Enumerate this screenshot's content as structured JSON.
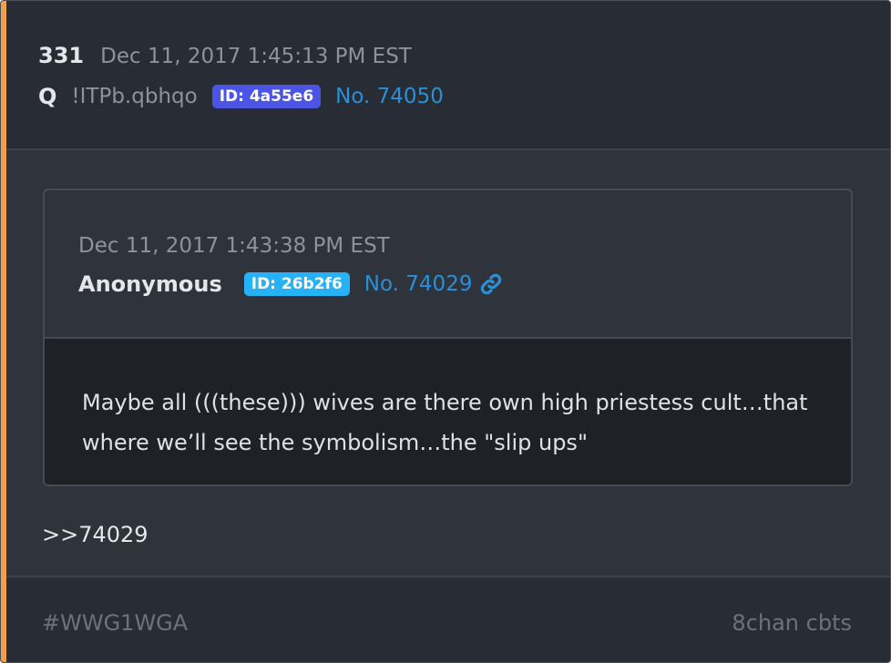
{
  "post": {
    "number": "331",
    "date": "Dec 11, 2017 1:45:13 PM EST",
    "author": "Q",
    "tripcode": "!ITPb.qbhqo",
    "id_label": "ID: 4a55e6",
    "id_color": "#4a55e6",
    "post_no": "No. 74050",
    "accent_color": "#f0a04b"
  },
  "quoted": {
    "date": "Dec 11, 2017 1:43:38 PM EST",
    "author": "Anonymous",
    "id_label": "ID: 26b2f6",
    "id_color": "#26b2f6",
    "post_no": "No. 74029",
    "link_icon": "link-icon",
    "text": "Maybe all (((these))) wives  are there own high priestess cult…that where we’ll see the symbolism…the \"slip ups\""
  },
  "reply": ">>74029",
  "footer": {
    "tag": "#WWG1WGA",
    "source": "8chan cbts"
  }
}
